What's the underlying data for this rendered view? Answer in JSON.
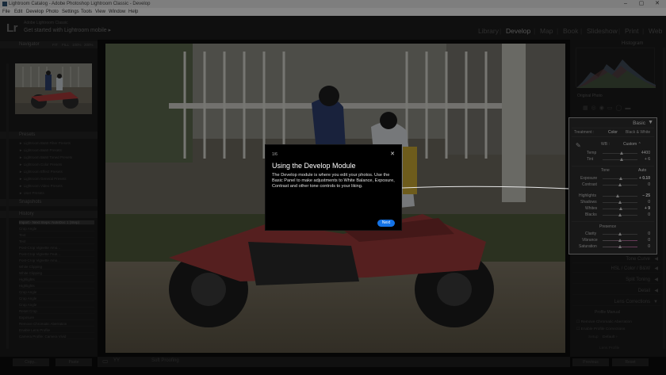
{
  "window": {
    "title": "Lightroom Catalog - Adobe Photoshop Lightroom Classic - Develop",
    "controls": [
      "–",
      "▢",
      "✕"
    ]
  },
  "menu": [
    "File",
    "Edit",
    "Develop",
    "Photo",
    "Settings",
    "Tools",
    "View",
    "Window",
    "Help"
  ],
  "identity": {
    "logo": "Lr",
    "subtitle": "Adobe Lightroom Classic",
    "main": "Get started with Lightroom mobile ▸"
  },
  "modules": [
    "Library",
    "Develop",
    "Map",
    "Book",
    "Slideshow",
    "Print",
    "Web"
  ],
  "active_module": "Develop",
  "left_panel": {
    "navigator": "Navigator",
    "nav_zoom": [
      "FIT",
      "FILL",
      "100%",
      "200%"
    ],
    "presets": "Presets",
    "preset_items": [
      "► Lightroom B&W Filter Presets",
      "► Lightroom B&W Presets",
      "► Lightroom B&W Toned Presets",
      "► Lightroom Color Presets",
      "► Lightroom Effect Presets",
      "► Lightroom General Presets",
      "► Lightroom Video Presets",
      "► User Presets"
    ],
    "snapshots": "Snapshots",
    "history": "History",
    "history_items": [
      "Import - Next Steps: NoteDoc 1 (Step)",
      "Crop Angle",
      "Text",
      "Text",
      "Post-Crop Vignette Amo...",
      "Post-Crop Vignette Feat...",
      "Post-Crop Vignette Amo...",
      "White Clipping",
      "White Clipping",
      "Highlights",
      "Highlights",
      "Crop Angle",
      "Crop Angle",
      "Crop Angle",
      "Reset Crop",
      "Exposure",
      "Remove Chromatic Aberration",
      "Enable Lens Profile",
      "Camera Profile: Camera Vivid"
    ],
    "copy_btn": "Copy...",
    "paste_btn": "Paste"
  },
  "right_panel": {
    "histogram": "Histogram",
    "original_photo": "Original Photo",
    "basic": {
      "title": "Basic",
      "treatment_label": "Treatment :",
      "treatment_color": "Color",
      "treatment_bw": "Black & White",
      "wb_label": "WB :",
      "wb_value": "Custom ⌃",
      "temp_label": "Temp",
      "temp_value": "4400",
      "tint_label": "Tint",
      "tint_value": "+ 6",
      "tone_label": "Tone",
      "auto_label": "Auto",
      "exposure_label": "Exposure",
      "exposure_value": "+ 0.10",
      "contrast_label": "Contrast",
      "contrast_value": "0",
      "highlights_label": "Highlights",
      "highlights_value": "– 25",
      "shadows_label": "Shadows",
      "shadows_value": "0",
      "whites_label": "Whites",
      "whites_value": "+ 9",
      "blacks_label": "Blacks",
      "blacks_value": "0",
      "presence_label": "Presence",
      "clarity_label": "Clarity",
      "clarity_value": "0",
      "vibrance_label": "Vibrance",
      "vibrance_value": "0",
      "saturation_label": "Saturation",
      "saturation_value": "0"
    },
    "collapsed_sections": [
      "Tone Curve",
      "HSL / Color / B&W",
      "Split Toning",
      "Detail",
      "Lens Corrections"
    ],
    "lens_tabs": "Profile    Manual",
    "lens_opts": [
      "☐ Remove Chromatic Aberration",
      "☐ Enable Profile Corrections"
    ],
    "lens_setup_label": "Setup",
    "lens_setup_value": "Default ÷",
    "lens_lens_profile": "Lens Profile",
    "previous_btn": "Previous",
    "reset_btn": "Reset"
  },
  "toolbar": {
    "soft_proofing": "Soft Proofing",
    "views": [
      "▭",
      "YY"
    ]
  },
  "dialog": {
    "step": "1/6",
    "title": "Using the Develop Module",
    "body": "The Develop module is where you edit your photos. Use the Basic Panel to make adjustments to White Balance, Exposure, Contrast and other tone controls to your liking.",
    "next_label": "Next",
    "close_label": "✕"
  },
  "sliders": {
    "temp": 0.55,
    "tint": 0.55,
    "exposure": 0.52,
    "contrast": 0.5,
    "highlights": 0.43,
    "shadows": 0.5,
    "whites": 0.53,
    "blacks": 0.5,
    "clarity": 0.5,
    "vibrance": 0.5,
    "saturation": 0.5
  }
}
